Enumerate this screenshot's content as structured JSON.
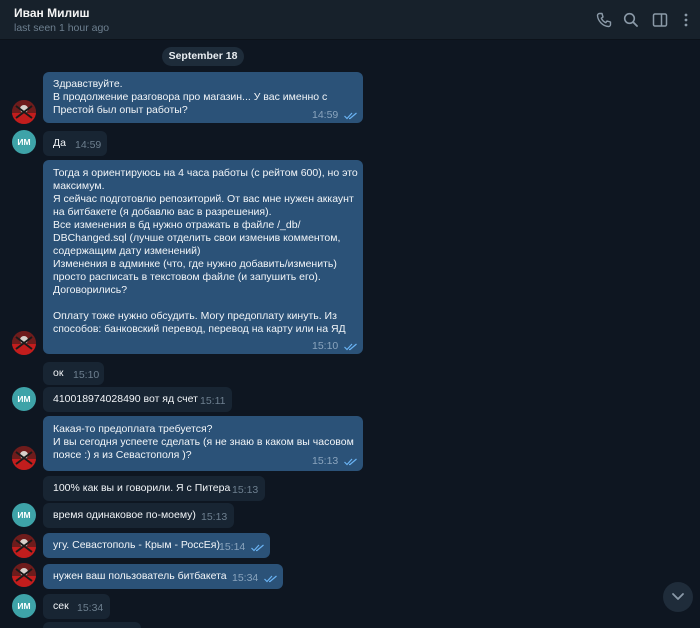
{
  "header": {
    "contact_name": "Иван Милиш",
    "status": "last seen 1 hour ago",
    "icons": [
      "phone-icon",
      "search-icon",
      "sidebar-toggle-icon",
      "more-icon"
    ]
  },
  "date_separator": "September 18",
  "avatar_initials": "ИМ",
  "messages": [
    {
      "direction": "out",
      "text": "Здравствуйте.\nВ продолжение разговора про магазин... У вас именно с\nПрестой был опыт работы?",
      "time": "14:59",
      "read": true
    },
    {
      "direction": "in",
      "text": "Да",
      "time": "14:59"
    },
    {
      "direction": "out",
      "text": "Тогда я ориентируюсь на 4 часа работы (с рейтом 600), но это\nмаксимум.\nЯ сейчас подготовлю репозиторий. От вас мне нужен аккаунт\nна битбакете (я добавлю вас в разрешения).\nВсе изменения в бд нужно отражать в файле /_db/\nDBChanged.sql (лучше отделить свои изменив комментом,\nсодержащим дату изменений)\nИзменения в админке (что, где нужно добавить/изменить)\nпросто расписать в текстовом файле (и запушить его).\nДоговорились?\n\nОплату тоже нужно обсудить. Могу предоплату кинуть. Из\nспособов: банковский перевод, перевод на карту или на ЯД",
      "time": "15:10",
      "read": true
    },
    {
      "direction": "in",
      "text": "ок",
      "time": "15:10"
    },
    {
      "direction": "in",
      "text": "410018974028490 вот яд счет",
      "time": "15:11"
    },
    {
      "direction": "out",
      "text": "Какая-то предоплата требуется?\nИ вы сегодня успеете сделать (я не знаю в каком вы часовом\nпоясе :) я из Севастополя )?",
      "time": "15:13",
      "read": true
    },
    {
      "direction": "in",
      "text": "100% как вы и говорили. Я с Питера",
      "time": "15:13"
    },
    {
      "direction": "in",
      "text": "время одинаковое по-моему)",
      "time": "15:13"
    },
    {
      "direction": "out",
      "text": "угу. Севастополь - Крым - РоссЕя)",
      "time": "15:14",
      "read": true
    },
    {
      "direction": "out",
      "text": "нужен ваш пользователь битбакета",
      "time": "15:34",
      "read": true
    },
    {
      "direction": "in",
      "text": "сек",
      "time": "15:34"
    }
  ]
}
